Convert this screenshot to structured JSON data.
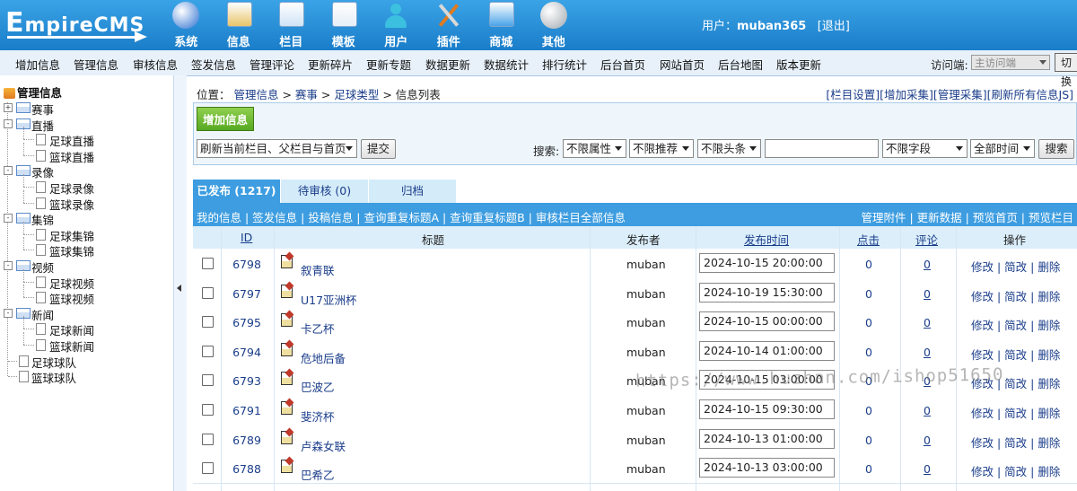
{
  "header": {
    "logo": "EmpireCMS",
    "nav": [
      {
        "label": "系统",
        "icon": "globe-icon"
      },
      {
        "label": "信息",
        "icon": "notepad-icon"
      },
      {
        "label": "栏目",
        "icon": "folder-icon"
      },
      {
        "label": "模板",
        "icon": "window-icon"
      },
      {
        "label": "用户",
        "icon": "user-icon"
      },
      {
        "label": "插件",
        "icon": "tools-icon"
      },
      {
        "label": "商城",
        "icon": "card-icon"
      },
      {
        "label": "其他",
        "icon": "gear-icon"
      }
    ],
    "user_label": "用户：",
    "username": "muban365",
    "logout": "[退出]"
  },
  "menubar": {
    "items": [
      "增加信息",
      "管理信息",
      "审核信息",
      "签发信息",
      "管理评论",
      "更新碎片",
      "更新专题",
      "数据更新",
      "数据统计",
      "排行统计",
      "后台首页",
      "网站首页",
      "后台地图",
      "版本更新"
    ],
    "visit_label": "访问端:",
    "visit_value": "主访问端",
    "switch_label": "切换"
  },
  "tree": {
    "root": "管理信息",
    "nodes": [
      {
        "label": "赛事",
        "level": 0,
        "toggle": "+",
        "type": "folder"
      },
      {
        "label": "直播",
        "level": 0,
        "toggle": "-",
        "type": "folder"
      },
      {
        "label": "足球直播",
        "level": 1,
        "type": "doc"
      },
      {
        "label": "篮球直播",
        "level": 1,
        "type": "doc"
      },
      {
        "label": "录像",
        "level": 0,
        "toggle": "-",
        "type": "folder"
      },
      {
        "label": "足球录像",
        "level": 1,
        "type": "doc"
      },
      {
        "label": "篮球录像",
        "level": 1,
        "type": "doc"
      },
      {
        "label": "集锦",
        "level": 0,
        "toggle": "-",
        "type": "folder"
      },
      {
        "label": "足球集锦",
        "level": 1,
        "type": "doc"
      },
      {
        "label": "篮球集锦",
        "level": 1,
        "type": "doc"
      },
      {
        "label": "视频",
        "level": 0,
        "toggle": "-",
        "type": "folder"
      },
      {
        "label": "足球视频",
        "level": 1,
        "type": "doc"
      },
      {
        "label": "篮球视频",
        "level": 1,
        "type": "doc"
      },
      {
        "label": "新闻",
        "level": 0,
        "toggle": "-",
        "type": "folder"
      },
      {
        "label": "足球新闻",
        "level": 1,
        "type": "doc"
      },
      {
        "label": "篮球新闻",
        "level": 1,
        "type": "doc"
      },
      {
        "label": "足球球队",
        "level": 0,
        "type": "doc"
      },
      {
        "label": "篮球球队",
        "level": 0,
        "type": "doc"
      }
    ]
  },
  "breadcrumb": {
    "prefix": "位置：",
    "items": [
      "管理信息",
      "赛事",
      "足球类型"
    ],
    "current": "信息列表",
    "sep": ">"
  },
  "toplinks": [
    "[栏目设置]",
    "[增加采集]",
    "[管理采集]",
    "[刷新所有信息JS]"
  ],
  "toolbar": {
    "add_label": "增加信息",
    "refresh_select": "刷新当前栏目、父栏目与首页",
    "submit_label": "提交",
    "search_label": "搜索:",
    "filters": [
      "不限属性",
      "不限推荐",
      "不限头条"
    ],
    "search_value": "",
    "field_select": "不限字段",
    "time_select": "全部时间",
    "search_button": "搜索"
  },
  "tabs": [
    {
      "label": "已发布 (1217)",
      "active": true
    },
    {
      "label": "待审核 (0)",
      "active": false
    },
    {
      "label": "归档",
      "active": false
    }
  ],
  "subbar": {
    "left": "我的信息 | 签发信息 | 投稿信息 | 查询重复标题A | 查询重复标题B | 审核栏目全部信息",
    "right": "管理附件 | 更新数据 | 预览首页 | 预览栏目"
  },
  "table": {
    "headers": {
      "id": "ID",
      "title": "标题",
      "publisher": "发布者",
      "time": "发布时间",
      "hits": "点击",
      "comments": "评论",
      "ops": "操作"
    },
    "rows": [
      {
        "id": "6798",
        "title": "叙青联",
        "publisher": "muban",
        "time": "2024-10-15 20:00:00",
        "hits": "0",
        "comments": "0"
      },
      {
        "id": "6797",
        "title": "U17亚洲杯",
        "publisher": "muban",
        "time": "2024-10-19 15:30:00",
        "hits": "0",
        "comments": "0"
      },
      {
        "id": "6795",
        "title": "卡乙杯",
        "publisher": "muban",
        "time": "2024-10-15 00:00:00",
        "hits": "0",
        "comments": "0"
      },
      {
        "id": "6794",
        "title": "危地后备",
        "publisher": "muban",
        "time": "2024-10-14 01:00:00",
        "hits": "0",
        "comments": "0"
      },
      {
        "id": "6793",
        "title": "巴波乙",
        "publisher": "muban",
        "time": "2024-10-15 03:00:00",
        "hits": "0",
        "comments": "0"
      },
      {
        "id": "6791",
        "title": "斐济杯",
        "publisher": "muban",
        "time": "2024-10-15 09:30:00",
        "hits": "0",
        "comments": "0"
      },
      {
        "id": "6789",
        "title": "卢森女联",
        "publisher": "muban",
        "time": "2024-10-13 01:00:00",
        "hits": "0",
        "comments": "0"
      },
      {
        "id": "6788",
        "title": "巴希乙",
        "publisher": "muban",
        "time": "2024-10-13 03:00:00",
        "hits": "0",
        "comments": "0"
      }
    ],
    "ops": "修改 | 简改 | 删除"
  },
  "watermark": "https://www.huzhan.com/ishop51650"
}
